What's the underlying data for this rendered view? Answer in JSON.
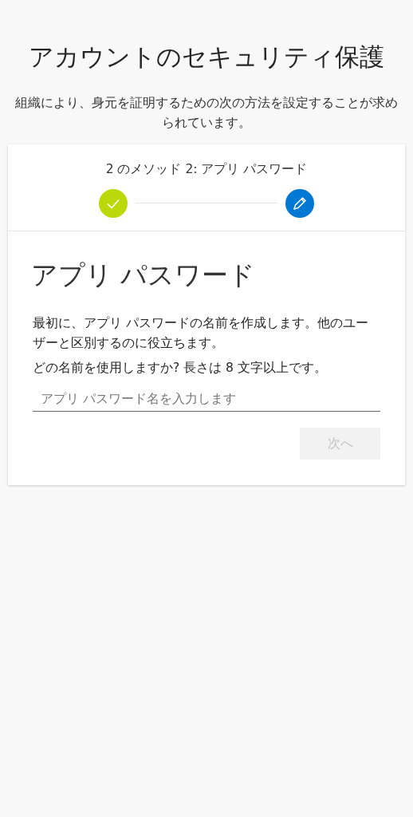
{
  "title": "アカウントのセキュリティ保護",
  "subtitle": "組織により、身元を証明するための次の方法を設定することが求められています。",
  "card": {
    "step_label": "2 のメソッド 2: アプリ パスワード",
    "steps": [
      {
        "kind": "done"
      },
      {
        "kind": "current"
      }
    ],
    "heading": "アプリ パスワード",
    "paragraphs": [
      "最初に、アプリ パスワードの名前を作成します。他のユーザーと区別するのに役立ちます。",
      "どの名前を使用しますか? 長さは 8 文字以上です。"
    ],
    "input": {
      "placeholder": "アプリ パスワード名を入力します"
    },
    "next_button": {
      "label": "次へ",
      "disabled": true
    }
  }
}
